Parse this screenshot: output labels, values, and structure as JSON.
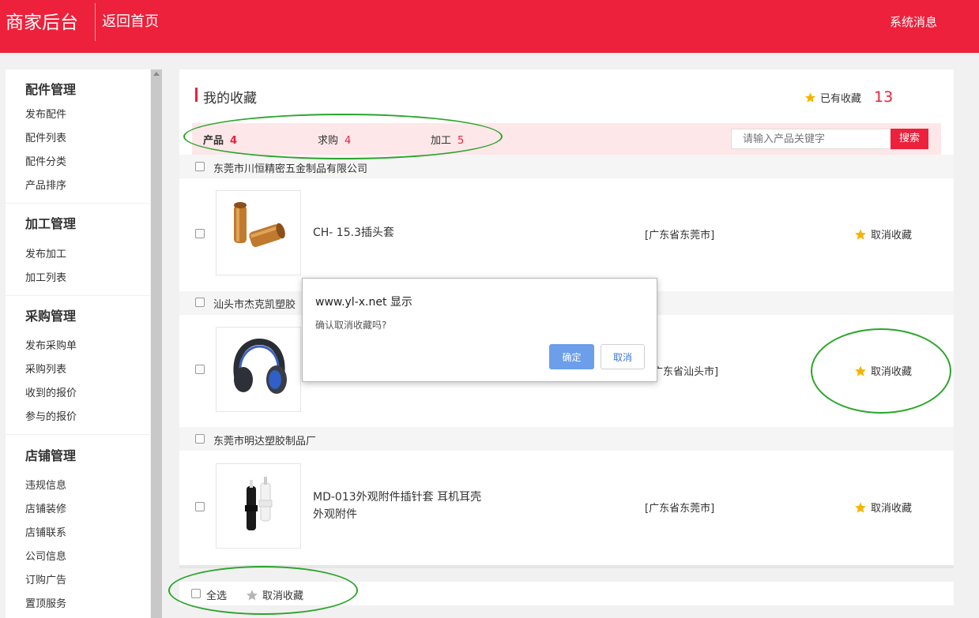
{
  "header": {
    "brand": "商家后台",
    "home_link": "返回首页",
    "system_messages": "系统消息"
  },
  "sidebar": {
    "sections": [
      {
        "title": "配件管理",
        "items": [
          "发布配件",
          "配件列表",
          "配件分类",
          "产品排序"
        ]
      },
      {
        "title": "加工管理",
        "items": [
          "发布加工",
          "加工列表"
        ]
      },
      {
        "title": "采购管理",
        "items": [
          "发布采购单",
          "采购列表",
          "收到的报价",
          "参与的报价"
        ]
      },
      {
        "title": "店铺管理",
        "items": [
          "违规信息",
          "店铺装修",
          "店铺联系",
          "公司信息",
          "订购广告",
          "置顶服务"
        ]
      }
    ]
  },
  "main": {
    "title": "我的收藏",
    "fav_label": "已有收藏",
    "fav_count": "13",
    "tabs": [
      {
        "label": "产品",
        "count": "4"
      },
      {
        "label": "求购",
        "count": "4"
      },
      {
        "label": "加工",
        "count": "5"
      }
    ],
    "search": {
      "placeholder": "请输入产品关键字",
      "button": "搜索"
    },
    "rows": [
      {
        "company": "东莞市川恒精密五金制品有限公司",
        "product": "CH- 15.3插头套",
        "product_line2": "",
        "region": "[广东省东莞市]",
        "action": "取消收藏"
      },
      {
        "company": "汕头市杰克凯塑胶",
        "product": "",
        "product_line2": "",
        "region": "广东省汕头市]",
        "action": "取消收藏"
      },
      {
        "company": "东莞市明达塑胶制品厂",
        "product": "MD-013外观附件插针套 耳机耳壳",
        "product_line2": "外观附件",
        "region": "[广东省东莞市]",
        "action": "取消收藏"
      }
    ],
    "bottom": {
      "select_all": "全选",
      "unfavorite": "取消收藏"
    }
  },
  "dialog": {
    "title": "www.yl-x.net 显示",
    "message": "确认取消收藏吗?",
    "ok": "确定",
    "cancel": "取消"
  },
  "colors": {
    "brand_red": "#ed213b",
    "star": "#f5b400",
    "annotation_green": "#2aa52a",
    "dialog_ok": "#6c9eea"
  }
}
